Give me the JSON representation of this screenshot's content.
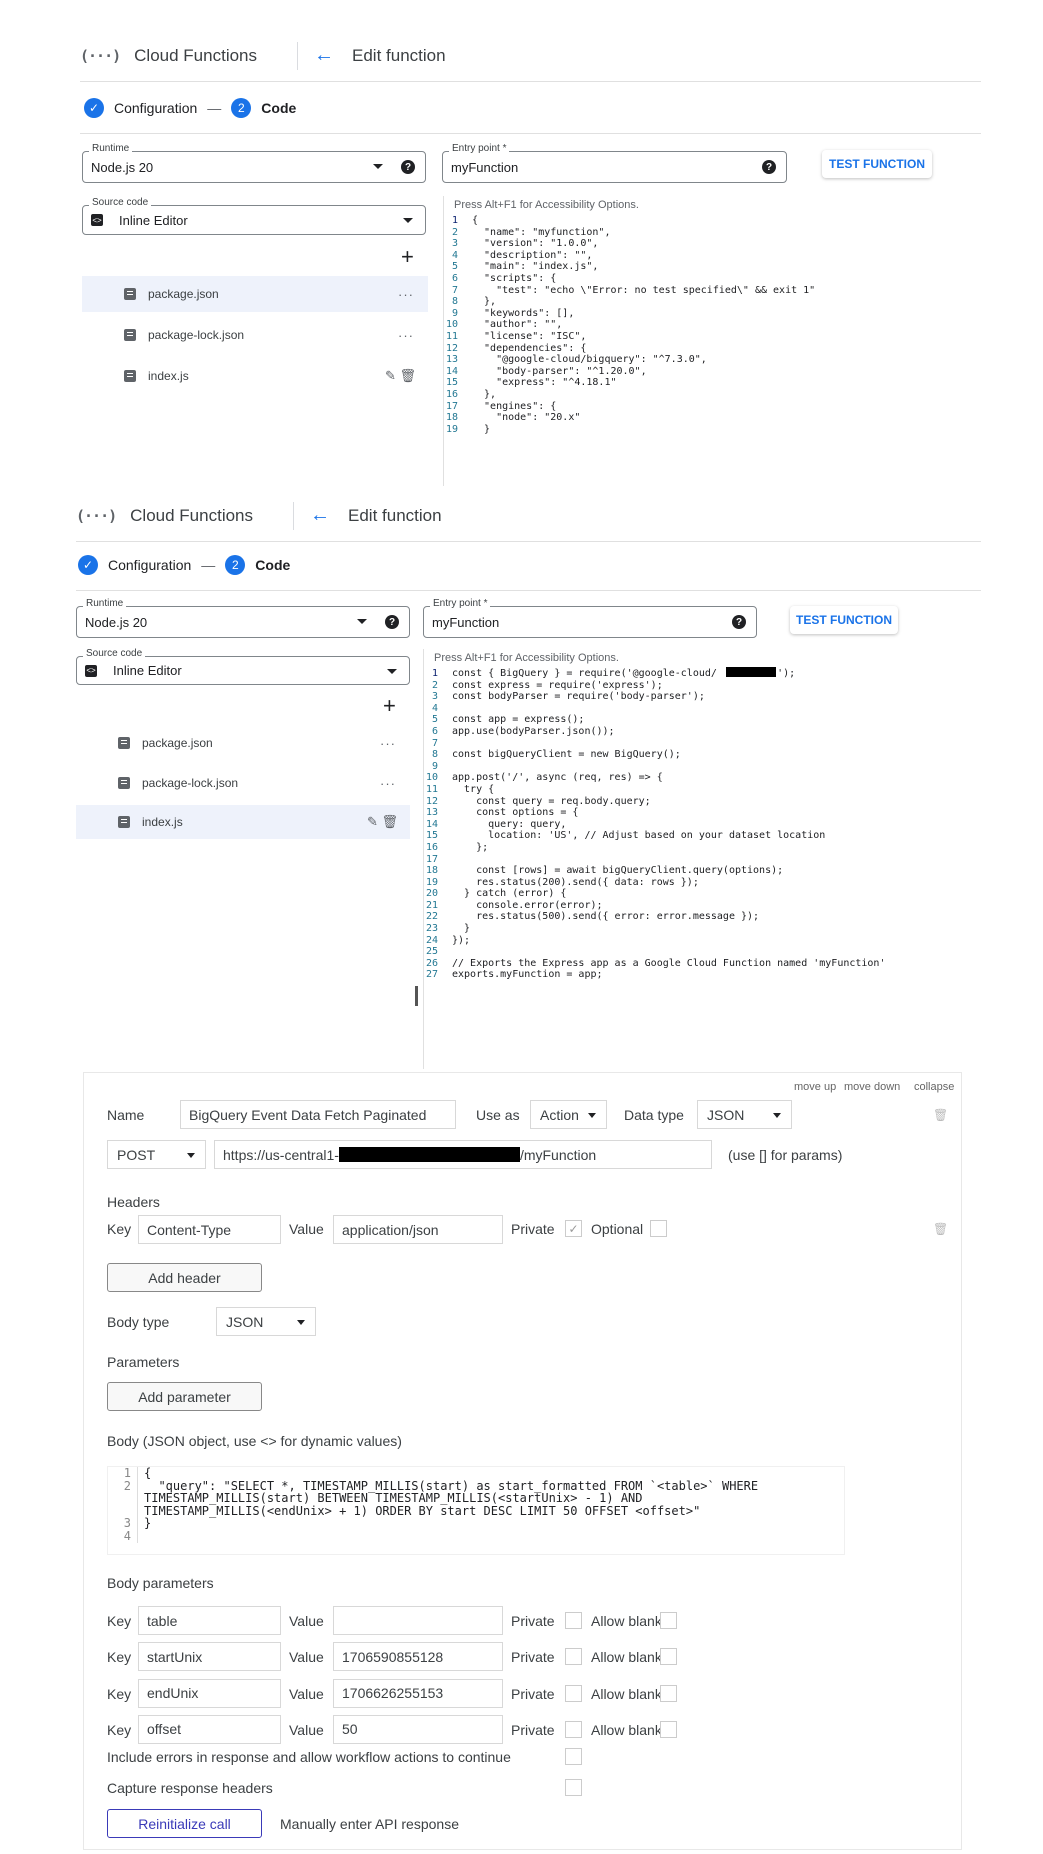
{
  "screen1": {
    "header": {
      "app_name": "Cloud Functions",
      "page_title": "Edit function"
    },
    "steps": {
      "step1": "Configuration",
      "step2_num": "2",
      "step2": "Code"
    },
    "runtime": {
      "label": "Runtime",
      "value": "Node.js 20"
    },
    "entry_point": {
      "label": "Entry point *",
      "value": "myFunction"
    },
    "test_button": "TEST FUNCTION",
    "source_code": {
      "label": "Source code",
      "value": "Inline Editor"
    },
    "files": [
      "package.json",
      "package-lock.json",
      "index.js"
    ],
    "editor_hint": "Press Alt+F1 for Accessibility Options.",
    "code_lines": [
      "{",
      "  \"name\": \"myfunction\",",
      "  \"version\": \"1.0.0\",",
      "  \"description\": \"\",",
      "  \"main\": \"index.js\",",
      "  \"scripts\": {",
      "    \"test\": \"echo \\\"Error: no test specified\\\" && exit 1\"",
      "  },",
      "  \"keywords\": [],",
      "  \"author\": \"\",",
      "  \"license\": \"ISC\",",
      "  \"dependencies\": {",
      "    \"@google-cloud/bigquery\": \"^7.3.0\",",
      "    \"body-parser\": \"^1.20.0\",",
      "    \"express\": \"^4.18.1\"",
      "  },",
      "  \"engines\": {",
      "    \"node\": \"20.x\"",
      "  }"
    ]
  },
  "screen2": {
    "header": {
      "app_name": "Cloud Functions",
      "page_title": "Edit function"
    },
    "steps": {
      "step1": "Configuration",
      "step2_num": "2",
      "step2": "Code"
    },
    "runtime": {
      "label": "Runtime",
      "value": "Node.js 20"
    },
    "entry_point": {
      "label": "Entry point *",
      "value": "myFunction"
    },
    "test_button": "TEST FUNCTION",
    "source_code": {
      "label": "Source code",
      "value": "Inline Editor"
    },
    "files": [
      "package.json",
      "package-lock.json",
      "index.js"
    ],
    "editor_hint": "Press Alt+F1 for Accessibility Options.",
    "code_lines": [
      "const { BigQuery } = require('@google-cloud/          ');",
      "const express = require('express');",
      "const bodyParser = require('body-parser');",
      "",
      "const app = express();",
      "app.use(bodyParser.json());",
      "",
      "const bigQueryClient = new BigQuery();",
      "",
      "app.post('/', async (req, res) => {",
      "  try {",
      "    const query = req.body.query;",
      "    const options = {",
      "      query: query,",
      "      location: 'US', // Adjust based on your dataset location",
      "    };",
      "",
      "    const [rows] = await bigQueryClient.query(options);",
      "    res.status(200).send({ data: rows });",
      "  } catch (error) {",
      "    console.error(error);",
      "    res.status(500).send({ error: error.message });",
      "  }",
      "});",
      "",
      "// Exports the Express app as a Google Cloud Function named 'myFunction'",
      "exports.myFunction = app;"
    ]
  },
  "api_card": {
    "top_links": {
      "move_up": "move up",
      "move_down": "move down",
      "collapse": "collapse"
    },
    "name_label": "Name",
    "name_value": "BigQuery Event Data Fetch Paginated",
    "use_as_label": "Use as",
    "use_as_value": "Action",
    "data_type_label": "Data type",
    "data_type_value": "JSON",
    "method": "POST",
    "url_prefix": "https://us-central1-",
    "url_suffix": "/myFunction",
    "url_hint": "(use [] for params)",
    "headers_title": "Headers",
    "header_row": {
      "key_label": "Key",
      "key": "Content-Type",
      "value_label": "Value",
      "value": "application/json",
      "private_label": "Private",
      "optional_label": "Optional"
    },
    "add_header": "Add header",
    "body_type_label": "Body type",
    "body_type_value": "JSON",
    "parameters_title": "Parameters",
    "add_parameter": "Add parameter",
    "body_title": "Body (JSON object, use <> for dynamic values)",
    "body_lines": [
      {
        "n": "1",
        "t": "{"
      },
      {
        "n": "2",
        "t": "  \"query\": \"SELECT *, TIMESTAMP_MILLIS(start) as start_formatted FROM `<table>` WHERE"
      },
      {
        "n": "",
        "t": "TIMESTAMP_MILLIS(start) BETWEEN TIMESTAMP_MILLIS(<startUnix> - 1) AND"
      },
      {
        "n": "",
        "t": "TIMESTAMP_MILLIS(<endUnix> + 1) ORDER BY start DESC LIMIT 50 OFFSET <offset>\""
      },
      {
        "n": "3",
        "t": "}"
      },
      {
        "n": "4",
        "t": ""
      }
    ],
    "body_params_title": "Body parameters",
    "body_params": [
      {
        "key": "table",
        "value": ""
      },
      {
        "key": "startUnix",
        "value": "1706590855128"
      },
      {
        "key": "endUnix",
        "value": "1706626255153"
      },
      {
        "key": "offset",
        "value": "50"
      }
    ],
    "key_label": "Key",
    "value_label": "Value",
    "private_label": "Private",
    "allow_blank_label": "Allow blank",
    "include_errors": "Include errors in response and allow workflow actions to continue",
    "capture_headers": "Capture response headers",
    "reinit": "Reinitialize call",
    "manual": "Manually enter API response"
  }
}
